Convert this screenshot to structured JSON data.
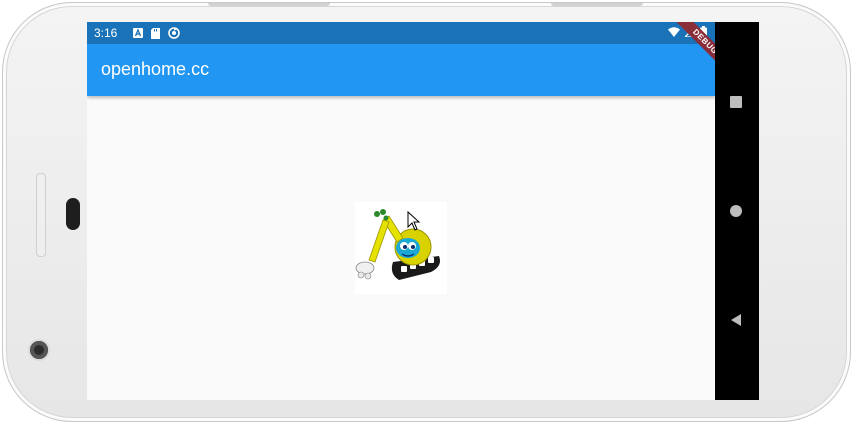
{
  "status_bar": {
    "time": "3:16",
    "left_icons": [
      "a-icon",
      "sd-card-icon",
      "sync-icon"
    ],
    "right_icons": [
      "wifi-icon",
      "signal-icon",
      "battery-icon"
    ]
  },
  "app_bar": {
    "title": "openhome.cc"
  },
  "debug_banner": {
    "label": "DEBUG",
    "color": "#8a2e3a"
  },
  "content": {
    "image": "robot-excavator-image"
  },
  "nav_bar": {
    "buttons": [
      "recent-apps-button",
      "home-button",
      "back-button"
    ]
  },
  "colors": {
    "status_bar": "#1a73b8",
    "app_bar": "#2196f3",
    "background": "#fafafa",
    "nav_bar": "#000000"
  }
}
